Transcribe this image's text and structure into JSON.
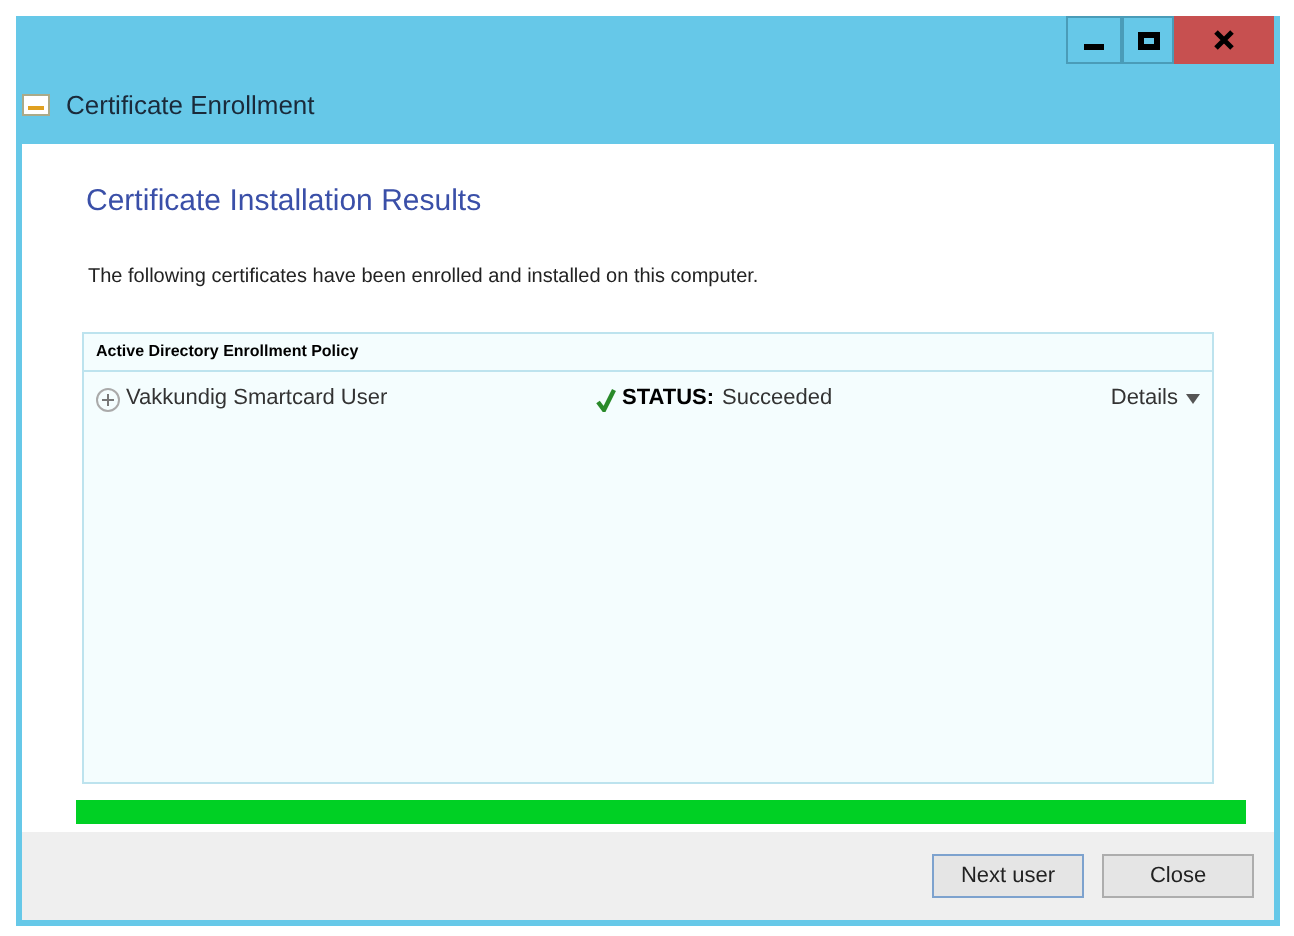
{
  "window": {
    "title": "Certificate Enrollment"
  },
  "heading": "Certificate Installation Results",
  "description": "The following certificates have been enrolled and installed on this computer.",
  "policy": {
    "title": "Active Directory Enrollment Policy",
    "items": [
      {
        "name": "Vakkundig Smartcard User",
        "expanded": false,
        "status_label": "STATUS:",
        "status_value": "Succeeded",
        "details": "Details"
      }
    ]
  },
  "progress": {
    "level": 1
  },
  "buttons": [
    {
      "label": "Next user",
      "default": true
    },
    {
      "label": "Close",
      "default": false
    }
  ]
}
